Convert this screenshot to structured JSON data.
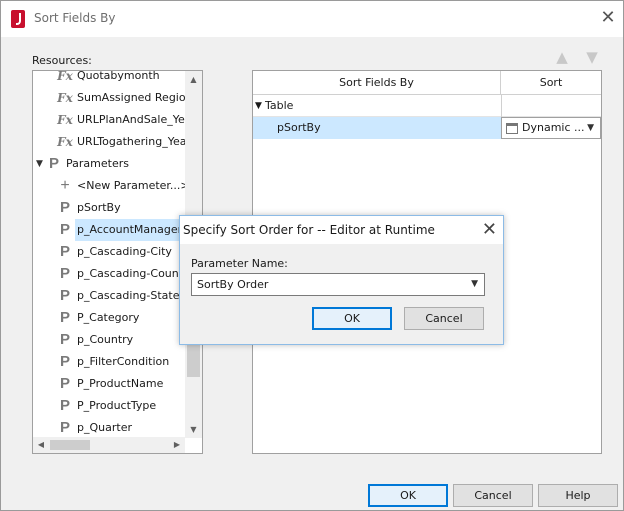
{
  "window": {
    "title": "Sort Fields By"
  },
  "resources": {
    "label": "Resources:",
    "items": [
      {
        "type": "formula",
        "label": "Quotabymonth"
      },
      {
        "type": "formula",
        "label": "SumAssigned Region"
      },
      {
        "type": "formula",
        "label": "URLPlanAndSale_Year"
      },
      {
        "type": "formula",
        "label": "URLTogathering_Year"
      },
      {
        "type": "folder",
        "label": "Parameters"
      },
      {
        "type": "new",
        "label": "<New Parameter...>"
      },
      {
        "type": "param",
        "label": "pSortBy"
      },
      {
        "type": "param",
        "label": "p_AccountManagerName"
      },
      {
        "type": "param",
        "label": "p_Cascading-City"
      },
      {
        "type": "param",
        "label": "p_Cascading-Country"
      },
      {
        "type": "param",
        "label": "p_Cascading-State"
      },
      {
        "type": "param",
        "label": "P_Category"
      },
      {
        "type": "param",
        "label": "p_Country"
      },
      {
        "type": "param",
        "label": "p_FilterCondition"
      },
      {
        "type": "param",
        "label": "P_ProductName"
      },
      {
        "type": "param",
        "label": "P_ProductType"
      },
      {
        "type": "param",
        "label": "p_Quarter"
      }
    ]
  },
  "grid": {
    "col_fields": "Sort Fields By",
    "col_sort": "Sort",
    "table_label": "Table",
    "field_label": "pSortBy",
    "sort_value": "Dynamic ..."
  },
  "dialog": {
    "title": "Specify Sort Order for -- Editor at Runtime",
    "param_label": "Parameter Name:",
    "param_value": "SortBy Order",
    "ok": "OK",
    "cancel": "Cancel"
  },
  "footer": {
    "ok": "OK",
    "cancel": "Cancel",
    "help": "Help"
  },
  "icons": {
    "formula": "Fx",
    "param": "P",
    "new": "+",
    "expand": "▼",
    "close": "✕",
    "up": "▲",
    "down": "▼",
    "left": "◀",
    "right": "▶"
  },
  "colors": {
    "selection": "#cce8ff",
    "accent": "#0078d7",
    "app_icon": "#c8102e"
  }
}
